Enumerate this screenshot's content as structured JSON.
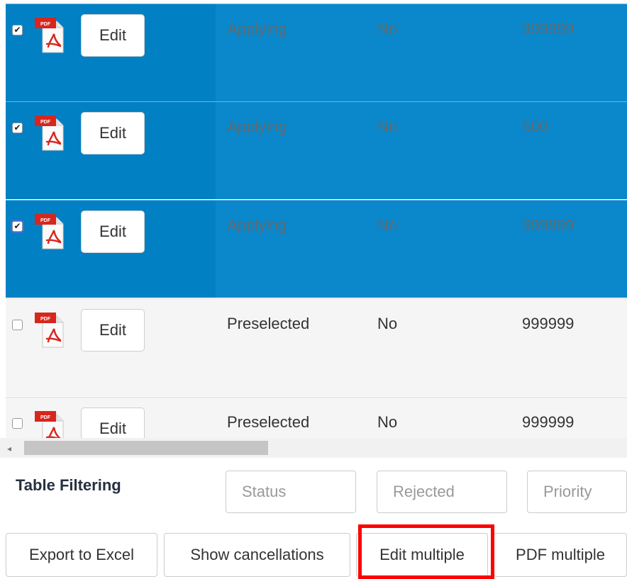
{
  "table": {
    "rows": [
      {
        "checked": "✔",
        "status": "Applying",
        "rejected": "No",
        "priority": "999999"
      },
      {
        "checked": "✔",
        "status": "Applying",
        "rejected": "No",
        "priority": "500"
      },
      {
        "checked": "✔",
        "status": "Applying",
        "rejected": "No",
        "priority": "999999"
      },
      {
        "checked": "",
        "status": "Preselected",
        "rejected": "No",
        "priority": "999999"
      },
      {
        "checked": "",
        "status": "Preselected",
        "rejected": "No",
        "priority": "999999"
      }
    ],
    "edit_label": "Edit",
    "pdf_badge": "PDF",
    "selected_color": "#0a88cb"
  },
  "scrollbar": {
    "left_arrow": "◂"
  },
  "filtering": {
    "title": "Table Filtering",
    "status_placeholder": "Status",
    "rejected_placeholder": "Rejected",
    "priority_placeholder": "Priority"
  },
  "actions": {
    "export_excel": "Export to Excel",
    "show_cancellations": "Show cancellations",
    "edit_multiple": "Edit multiple",
    "pdf_multiple": "PDF multiple"
  },
  "highlight_color": "#ff0000"
}
